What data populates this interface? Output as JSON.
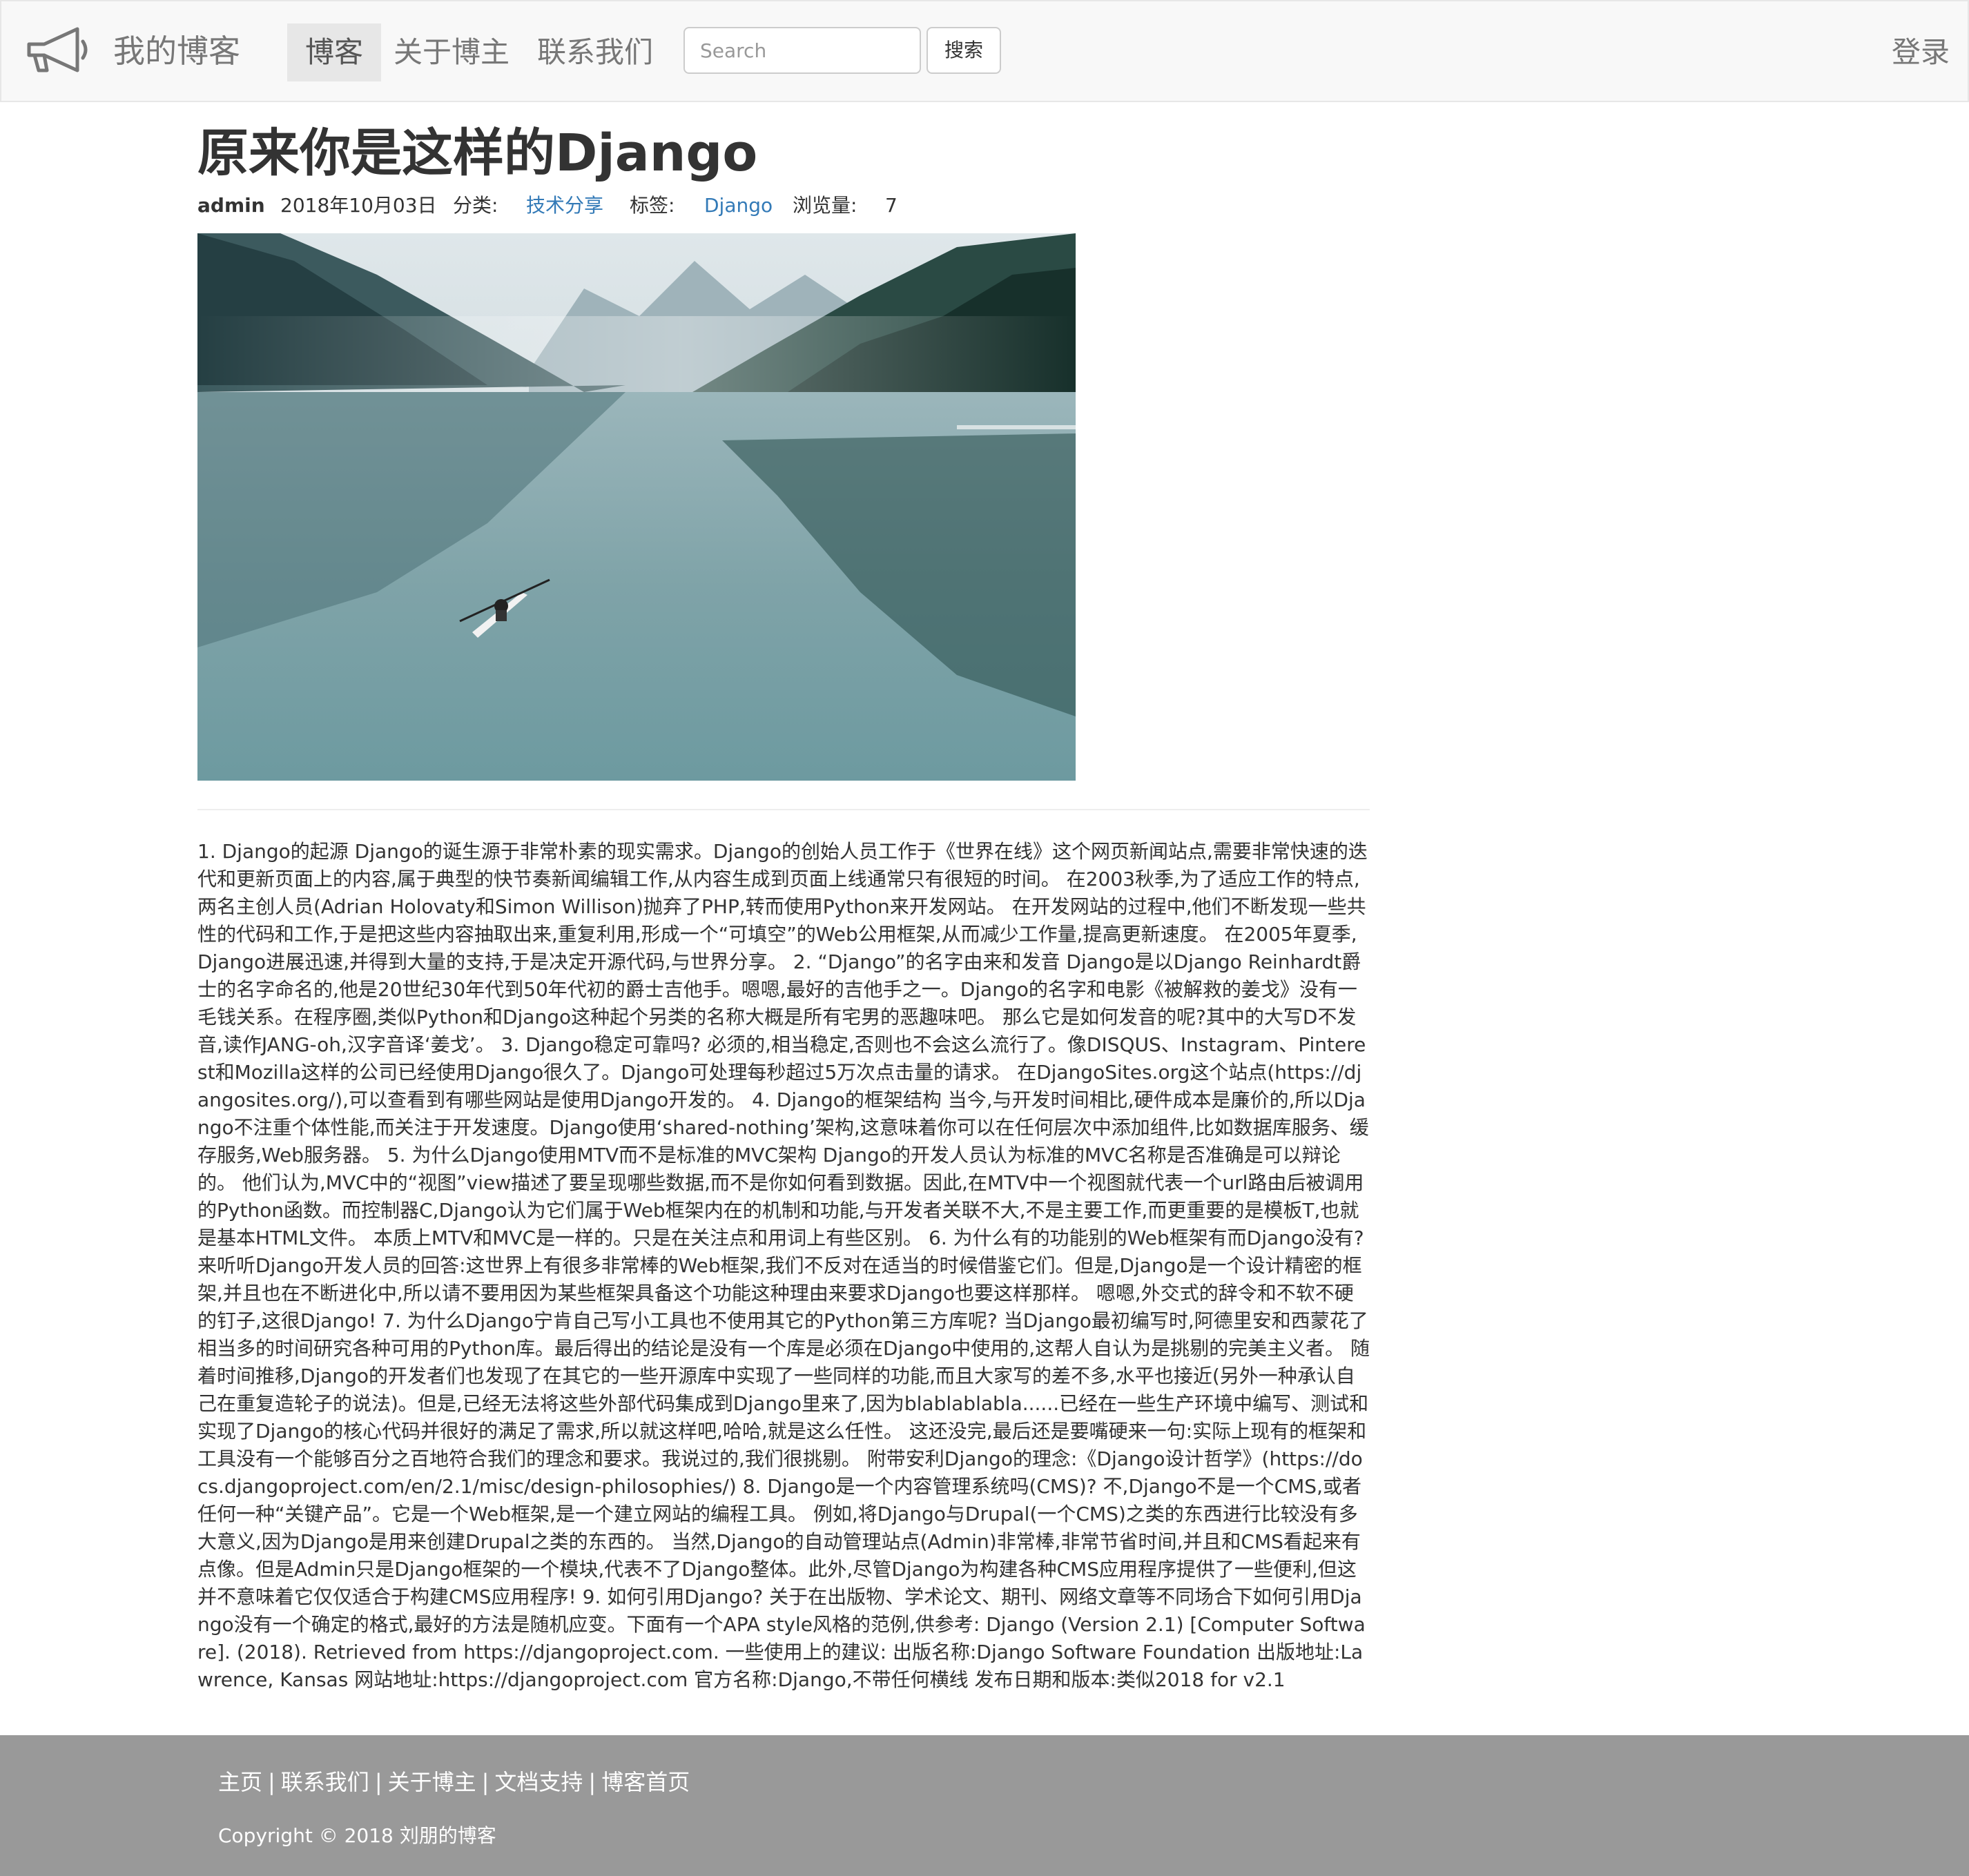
{
  "navbar": {
    "brand": "我的博客",
    "brand_icon": "megaphone-icon",
    "items": [
      {
        "label": "博客",
        "active": true
      },
      {
        "label": "关于博主",
        "active": false
      },
      {
        "label": "联系我们",
        "active": false
      }
    ],
    "search": {
      "placeholder": "Search",
      "value": "",
      "button_label": "搜索"
    },
    "login_label": "登录"
  },
  "article": {
    "title": "原来你是这样的Django",
    "author": "admin",
    "date": "2018年10月03日",
    "category_label": "分类:",
    "category": "技术分享",
    "tag_label": "标签:",
    "tag": "Django",
    "views_label": "浏览量:",
    "views": "7",
    "image_alt": "Lake with kayaker between mountains",
    "body": "1. Django的起源 Django的诞生源于非常朴素的现实需求。Django的创始人员工作于《世界在线》这个网页新闻站点,需要非常快速的迭代和更新页面上的内容,属于典型的快节奏新闻编辑工作,从内容生成到页面上线通常只有很短的时间。 在2003秋季,为了适应工作的特点,两名主创人员(Adrian Holovaty和Simon Willison)抛弃了PHP,转而使用Python来开发网站。 在开发网站的过程中,他们不断发现一些共性的代码和工作,于是把这些内容抽取出来,重复利用,形成一个“可填空”的Web公用框架,从而减少工作量,提高更新速度。 在2005年夏季,Django进展迅速,并得到大量的支持,于是决定开源代码,与世界分享。 2. “Django”的名字由来和发音 Django是以Django Reinhardt爵士的名字命名的,他是20世纪30年代到50年代初的爵士吉他手。嗯嗯,最好的吉他手之一。Django的名字和电影《被解救的姜戈》没有一毛钱关系。在程序圈,类似Python和Django这种起个另类的名称大概是所有宅男的恶趣味吧。 那么它是如何发音的呢?其中的大写D不发音,读作JANG-oh,汉字音译‘姜戈’。 3. Django稳定可靠吗? 必须的,相当稳定,否则也不会这么流行了。像DISQUS、Instagram、Pinterest和Mozilla这样的公司已经使用Django很久了。Django可处理每秒超过5万次点击量的请求。 在DjangoSites.org这个站点(https://djangosites.org/),可以查看到有哪些网站是使用Django开发的。 4. Django的框架结构 当今,与开发时间相比,硬件成本是廉价的,所以Django不注重个体性能,而关注于开发速度。Django使用‘shared-nothing’架构,这意味着你可以在任何层次中添加组件,比如数据库服务、缓存服务,Web服务器。 5. 为什么Django使用MTV而不是标准的MVC架构 Django的开发人员认为标准的MVC名称是否准确是可以辩论的。 他们认为,MVC中的“视图”view描述了要呈现哪些数据,而不是你如何看到数据。因此,在MTV中一个视图就代表一个url路由后被调用的Python函数。而控制器C,Django认为它们属于Web框架内在的机制和功能,与开发者关联不大,不是主要工作,而更重要的是模板T,也就是基本HTML文件。 本质上MTV和MVC是一样的。只是在关注点和用词上有些区别。 6. 为什么有的功能别的Web框架有而Django没有? 来听听Django开发人员的回答:这世界上有很多非常棒的Web框架,我们不反对在适当的时候借鉴它们。但是,Django是一个设计精密的框架,并且也在不断进化中,所以请不要用因为某些框架具备这个功能这种理由来要求Django也要这样那样。 嗯嗯,外交式的辞令和不软不硬的钉子,这很Django! 7. 为什么Django宁肯自己写小工具也不使用其它的Python第三方库呢? 当Django最初编写时,阿德里安和西蒙花了相当多的时间研究各种可用的Python库。最后得出的结论是没有一个库是必须在Django中使用的,这帮人自认为是挑剔的完美主义者。 随着时间推移,Django的开发者们也发现了在其它的一些开源库中实现了一些同样的功能,而且大家写的差不多,水平也接近(另外一种承认自己在重复造轮子的说法)。但是,已经无法将这些外部代码集成到Django里来了,因为blablablabla......已经在一些生产环境中编写、测试和实现了Django的核心代码并很好的满足了需求,所以就这样吧,哈哈,就是这么任性。 这还没完,最后还是要嘴硬来一句:实际上现有的框架和工具没有一个能够百分之百地符合我们的理念和要求。我说过的,我们很挑剔。 附带安利Django的理念:《Django设计哲学》(https://docs.djangoproject.com/en/2.1/misc/design-philosophies/) 8. Django是一个内容管理系统吗(CMS)? 不,Django不是一个CMS,或者任何一种“关键产品”。它是一个Web框架,是一个建立网站的编程工具。 例如,将Django与Drupal(一个CMS)之类的东西进行比较没有多大意义,因为Django是用来创建Drupal之类的东西的。 当然,Django的自动管理站点(Admin)非常棒,非常节省时间,并且和CMS看起来有点像。但是Admin只是Django框架的一个模块,代表不了Django整体。此外,尽管Django为构建各种CMS应用程序提供了一些便利,但这并不意味着它仅仅适合于构建CMS应用程序! 9. 如何引用Django? 关于在出版物、学术论文、期刊、网络文章等不同场合下如何引用Django没有一个确定的格式,最好的方法是随机应变。下面有一个APA style风格的范例,供参考: Django (Version 2.1) [Computer Software]. (2018). Retrieved from https://djangoproject.com. 一些使用上的建议: 出版名称:Django Software Foundation 出版地址:Lawrence, Kansas 网站地址:https://djangoproject.com 官方名称:Django,不带任何横线 发布日期和版本:类似2018 for v2.1"
  },
  "footer": {
    "links": [
      "主页",
      "联系我们",
      "关于博主",
      "文档支持",
      "博客首页"
    ],
    "separator": "|",
    "copyright": "Copyright © 2018 刘朋的博客"
  },
  "colors": {
    "navbar_bg": "#f8f8f8",
    "link": "#337ab7",
    "footer_bg": "#999999",
    "text": "#333333"
  }
}
